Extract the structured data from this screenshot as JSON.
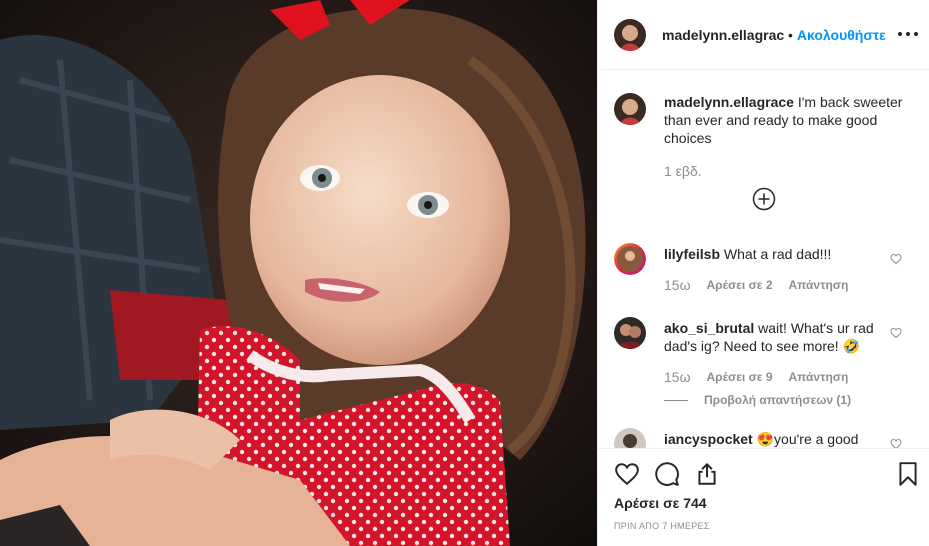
{
  "post": {
    "photo_alt": "",
    "header": {
      "username": "madelynn.ellagrace",
      "dot": "•",
      "follow_label": "Ακολουθήστε"
    },
    "caption": {
      "username": "madelynn.ellagrace",
      "text": "I'm back sweeter than ever and ready to make good choices",
      "time": "1 εβδ."
    },
    "comments": [
      {
        "username": "lilyfeilsb",
        "text": "What a rad dad!!!",
        "time": "15ω",
        "likes_label": "Αρέσει σε 2",
        "reply_label": "Απάντηση"
      },
      {
        "username": "ako_si_brutal",
        "text": "wait! What's ur rad dad's ig? Need to see more! 🤣",
        "time": "15ω",
        "likes_label": "Αρέσει σε 9",
        "reply_label": "Απάντηση",
        "view_replies_label": "Προβολή απαντήσεων (1)"
      },
      {
        "username": "iancyspocket",
        "text": "😍you're a good",
        "time": "",
        "likes_label": "",
        "reply_label": ""
      }
    ],
    "likes_label": "Αρέσει σε 744",
    "posted_label": "ΠΡΙΝ ΑΠΟ 7 ΗΜΕΡΕΣ"
  },
  "icons": {
    "more": "more-options-icon",
    "load_more": "plus-circle-icon",
    "heart": "heart-outline-icon",
    "like": "heart-outline-icon",
    "comment": "speech-bubble-icon",
    "share": "share-icon",
    "save": "bookmark-icon"
  },
  "colors": {
    "link": "#0095f6",
    "text": "#262626",
    "muted": "#8e8e8e",
    "border": "#efefef"
  }
}
